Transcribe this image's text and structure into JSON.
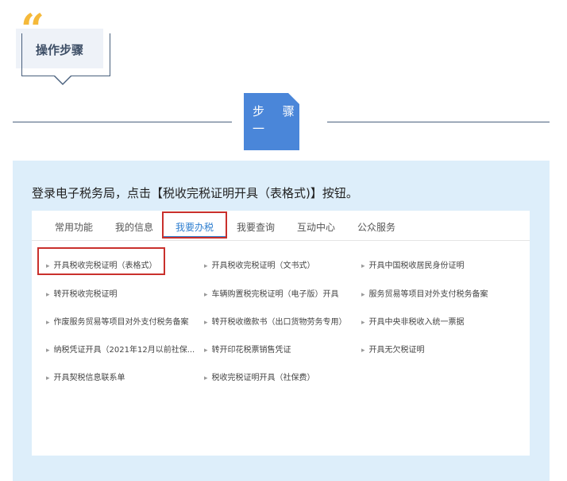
{
  "header": {
    "quote_glyph": "“",
    "title": "操作步骤"
  },
  "step": {
    "label": "步 骤",
    "number": "一"
  },
  "instruction": "登录电子税务局，点击【税收完税证明开具（表格式)】按钮。",
  "screenshot": {
    "tabs": [
      {
        "label": "常用功能"
      },
      {
        "label": "我的信息"
      },
      {
        "label": "我要办税"
      },
      {
        "label": "我要查询"
      },
      {
        "label": "互动中心"
      },
      {
        "label": "公众服务"
      }
    ],
    "active_tab": "我要办税",
    "items": {
      "col1": [
        "开具税收完税证明（表格式）",
        "转开税收完税证明",
        "作废服务贸易等项目对外支付税务备案",
        "纳税凭证开具（2021年12月以前社保...",
        "开具契税信息联系单"
      ],
      "col2": [
        "开具税收完税证明（文书式）",
        "车辆购置税完税证明（电子版）开具",
        "转开税收缴款书（出口货物劳务专用）",
        "转开印花税票销售凭证",
        "税收完税证明开具（社保费）"
      ],
      "col3": [
        "开具中国税收居民身份证明",
        "服务贸易等项目对外支付税务备案",
        "开具中央非税收入统一票据",
        "开具无欠税证明"
      ]
    },
    "bullet": "▸"
  },
  "colors": {
    "accent_blue": "#4a86d9",
    "quote_yellow": "#f5b93a",
    "panel_bg": "#ddeefa",
    "highlight_red": "#c9302c",
    "active_tab": "#2f7fd0"
  }
}
